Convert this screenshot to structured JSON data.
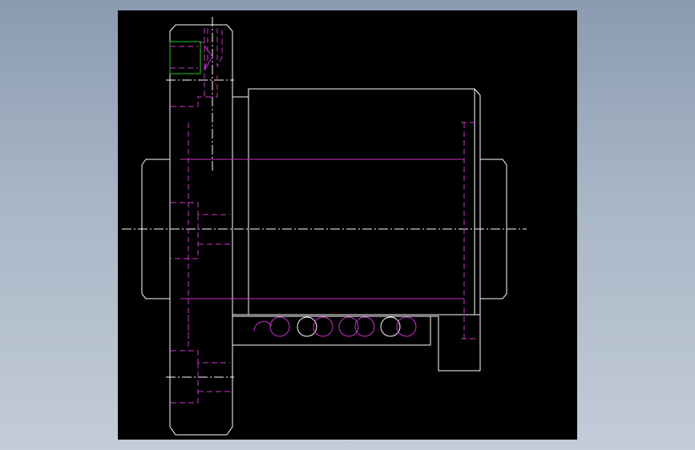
{
  "viewport": {
    "background": "#000000",
    "colors": {
      "outline": "#ffffff",
      "hidden_lines": "#cc33cc",
      "center_lines": "#ffffff",
      "highlight": "#22cc22"
    }
  },
  "drawing": {
    "subject": "ball-screw-nut-cross-section",
    "line_types": [
      "visible-outline",
      "hidden-dashed",
      "center-dash-dot",
      "selection-box"
    ]
  }
}
